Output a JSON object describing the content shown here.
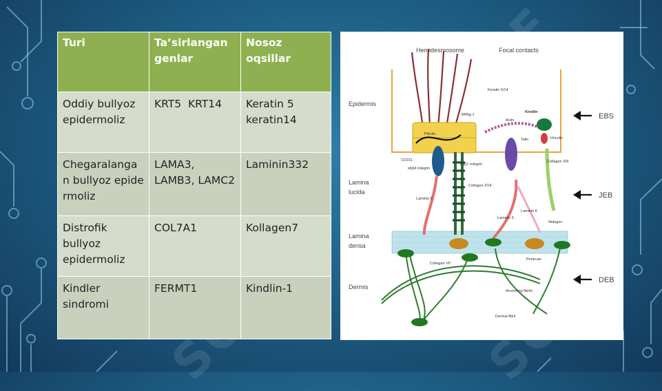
{
  "table": {
    "headers": [
      "Turi",
      "Ta’sirlangan genlar",
      "Nosoz oqsillar"
    ],
    "rows": [
      {
        "type": "Oddiy bullyoz epidermoliz",
        "genes": "KRT5  KRT14",
        "proteins": "Keratin 5 keratin14"
      },
      {
        "type": "Chegaralangan bullyoz epidermoliz",
        "genes": "LAMA3, LAMB3, LAMC2",
        "proteins": "Laminin332"
      },
      {
        "type": "Distrofik bullyoz epidermoliz",
        "genes": "COL7A1",
        "proteins": "Kollagen7"
      },
      {
        "type": "Kindler sindromi",
        "genes": "FERMT1",
        "proteins": "Kindlin-1"
      }
    ]
  },
  "figure": {
    "top_labels": {
      "hemidesmosome": "Hemidesmosome",
      "focal": "Focal contacts"
    },
    "layers": {
      "epidermis": "Epidermis",
      "lucida1": "Lamina",
      "lucida2": "lucida",
      "densa1": "Lamina",
      "densa2": "densa",
      "dermis": "Dermis"
    },
    "types": {
      "ebs": "EBS",
      "jeb": "JEB",
      "deb": "DEB"
    },
    "labels": {
      "keratin": "Keratin 5/14",
      "kindlin": "Kindlin",
      "bpag": "BPAg-1",
      "actin": "Actin",
      "plectin": "Plectin",
      "talin": "Talin",
      "vinculin": "Vinculin",
      "cd151": "CD151",
      "a6b4": "α6β4 Integrin",
      "a3b1": "α3β1 Integrin",
      "col17": "Collagen XVII",
      "col13": "Collagen XIII",
      "laminin5a": "Laminin 5",
      "laminin5b": "Laminin 5",
      "laminin6": "Laminin 6",
      "nidogen": "Nidogen",
      "perlecan": "Perlecan",
      "col7": "Collagen VII",
      "anchoring": "Anchoring fibrils",
      "dermal": "Dermal fibril"
    }
  },
  "watermark": "SOFF",
  "colors": {
    "header_green": "#8fb050",
    "cell": "#d5dccb",
    "bg": "#1f5f86"
  }
}
